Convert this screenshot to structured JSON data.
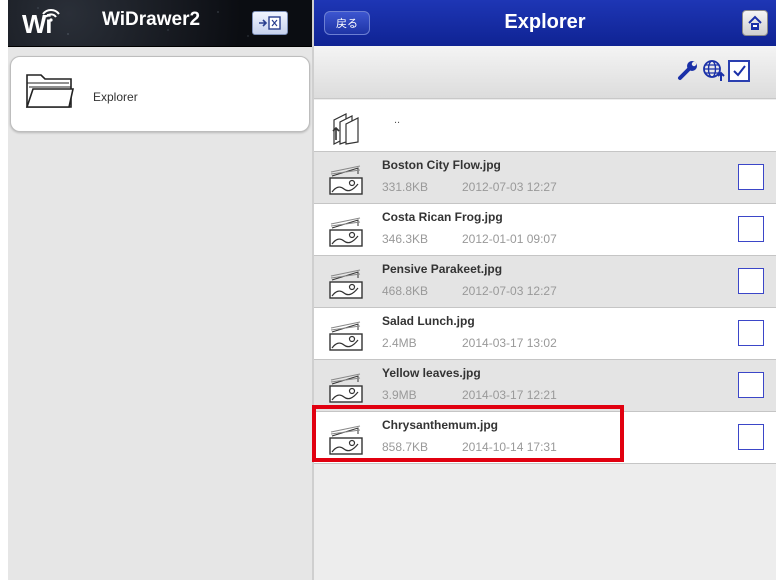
{
  "left": {
    "app_title": "WiDrawer2",
    "logo_text": "Wi",
    "explorer_label": "Explorer"
  },
  "right": {
    "back_label": "戻る",
    "title": "Explorer",
    "parent_label": "..",
    "files": [
      {
        "name": "Boston City Flow.jpg",
        "size": "331.8KB",
        "date": "2012-07-03 12:27"
      },
      {
        "name": "Costa Rican Frog.jpg",
        "size": "346.3KB",
        "date": "2012-01-01 09:07"
      },
      {
        "name": "Pensive Parakeet.jpg",
        "size": "468.8KB",
        "date": "2012-07-03 12:27"
      },
      {
        "name": "Salad Lunch.jpg",
        "size": "2.4MB",
        "date": "2014-03-17 13:02"
      },
      {
        "name": "Yellow leaves.jpg",
        "size": "3.9MB",
        "date": "2014-03-17 12:21"
      },
      {
        "name": "Chrysanthemum.jpg",
        "size": "858.7KB",
        "date": "2014-10-14 17:31"
      }
    ]
  },
  "icons": {
    "exit": "exit-icon",
    "home": "home-icon",
    "wrench": "wrench-icon",
    "globe": "globe-icon",
    "select_all": "checkbox-icon",
    "folder": "folder-icon",
    "image": "image-file-icon",
    "parent": "parent-folder-icon"
  },
  "colors": {
    "navbar": "#1a30a8",
    "checkbox_border": "#3b46c8",
    "highlight": "#e10010"
  }
}
